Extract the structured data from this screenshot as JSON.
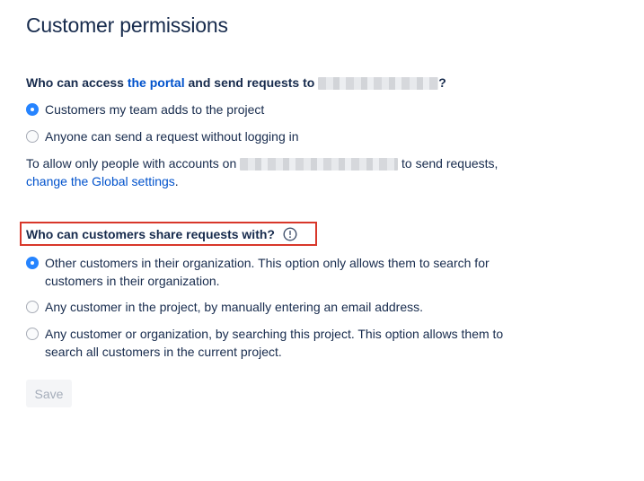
{
  "page": {
    "title": "Customer permissions"
  },
  "access_section": {
    "question_prefix": "Who can access ",
    "portal_link": "the portal",
    "question_middle": " and send requests to",
    "question_suffix": "?",
    "options": [
      {
        "label": "Customers my team adds to the project",
        "selected": true
      },
      {
        "label": "Anyone can send a request without logging in",
        "selected": false
      }
    ],
    "note_prefix": "To allow only people with accounts on",
    "note_suffix": " to send requests,",
    "global_settings_link": "change the Global settings",
    "note_end": "."
  },
  "share_section": {
    "question": "Who can customers share requests with?",
    "info_icon": "exclamation-circle-icon",
    "highlight_color": "#d8372a",
    "options": [
      {
        "label": "Other customers in their organization. This option only allows them to search for customers in their organization.",
        "selected": true
      },
      {
        "label": "Any customer in the project, by manually entering an email address.",
        "selected": false
      },
      {
        "label": "Any customer or organization, by searching this project. This option allows them to search all customers in the current project.",
        "selected": false
      }
    ]
  },
  "actions": {
    "save_label": "Save",
    "save_enabled": false
  },
  "colors": {
    "text": "#172b4d",
    "link": "#0052cc",
    "radio_checked": "#2684ff"
  }
}
